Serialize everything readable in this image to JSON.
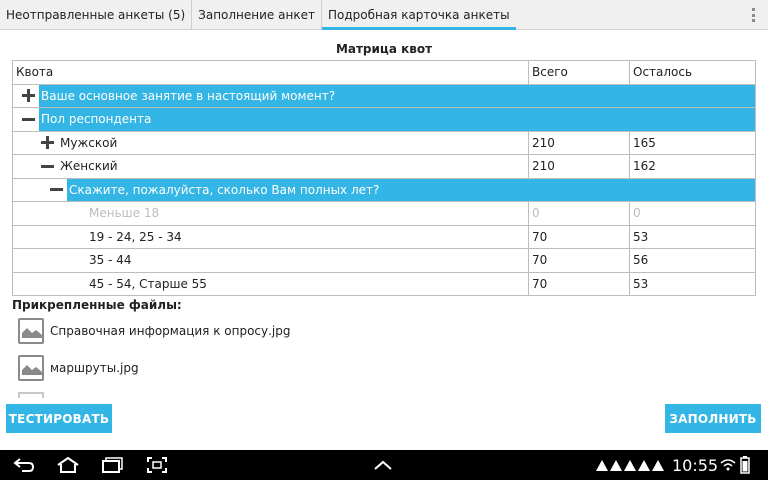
{
  "tabs": [
    {
      "label": "Неотправленные анкеты (5)",
      "active": false
    },
    {
      "label": "Заполнение анкет",
      "active": false
    },
    {
      "label": "Подробная карточка анкеты",
      "active": true
    }
  ],
  "matrix": {
    "title": "Матрица квот",
    "headers": {
      "quota": "Квота",
      "total": "Всего",
      "left": "Осталось"
    },
    "sections": {
      "occupation": "Ваше основное занятие в настоящий момент?",
      "gender": "Пол респондента",
      "age": "Скажите, пожалуйста, сколько Вам полных лет?"
    },
    "rows": {
      "male": {
        "label": "Мужской",
        "total": "210",
        "left": "165"
      },
      "female": {
        "label": "Женский",
        "total": "210",
        "left": "162"
      },
      "under18": {
        "label": "Меньше 18",
        "total": "0",
        "left": "0"
      },
      "age19_34": {
        "label": "19 - 24, 25 - 34",
        "total": "70",
        "left": "53"
      },
      "age35_44": {
        "label": "35 - 44",
        "total": "70",
        "left": "56"
      },
      "age45_55": {
        "label": "45 - 54, Старше 55",
        "total": "70",
        "left": "53"
      }
    }
  },
  "attachments": {
    "title": "Прикрепленные файлы:",
    "files": [
      {
        "name": "Справочная информация к опросу.jpg",
        "icon": "image-file-icon"
      },
      {
        "name": "маршруты.jpg",
        "icon": "image-file-icon"
      }
    ]
  },
  "buttons": {
    "test": "ТЕСТИРОВАТЬ",
    "fill": "ЗАПОЛНИТЬ"
  },
  "system_bar": {
    "time": "10:55"
  },
  "colors": {
    "accent": "#33b5e5",
    "disabled": "#bdbdbd"
  }
}
